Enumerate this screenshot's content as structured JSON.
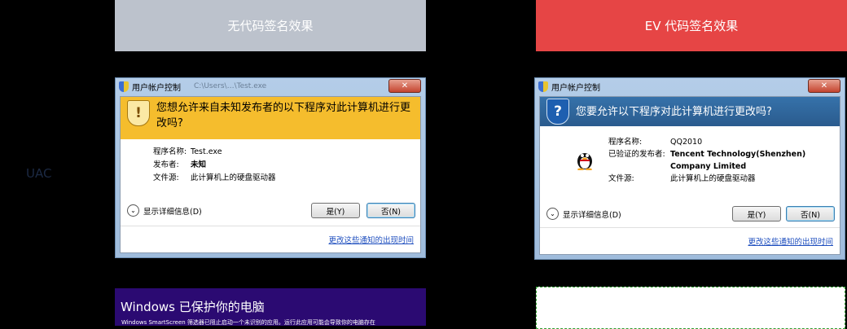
{
  "headers": {
    "left": "无代码签名效果",
    "right": "EV 代码签名效果"
  },
  "row_label": "UAC",
  "uac_left": {
    "title": "用户帐户控制",
    "title_blur": "C:\\Users\\…\\Test.exe",
    "close": "✕",
    "question": "您想允许来自未知发布者的以下程序对此计算机进行更改吗?",
    "program_label": "程序名称:",
    "program_value": "Test.exe",
    "publisher_label": "发布者:",
    "publisher_value": "未知",
    "source_label": "文件源:",
    "source_value": "此计算机上的硬盘驱动器",
    "details": "显示详细信息(D)",
    "yes": "是(Y)",
    "no": "否(N)",
    "change_link": "更改这些通知的出现时间"
  },
  "uac_right": {
    "title": "用户帐户控制",
    "close": "✕",
    "question": "您要允许以下程序对此计算机进行更改吗?",
    "program_label": "程序名称:",
    "program_value": "QQ2010",
    "publisher_label": "已验证的发布者:",
    "publisher_value_line1": "Tencent Technology(Shenzhen)",
    "publisher_value_line2": "Company Limited",
    "source_label": "文件源:",
    "source_value": "此计算机上的硬盘驱动器",
    "details": "显示详细信息(D)",
    "yes": "是(Y)",
    "no": "否(N)",
    "change_link": "更改这些通知的出现时间"
  },
  "smartscreen_left": {
    "title": "Windows 已保护你的电脑",
    "desc": "Windows SmartScreen 筛选器已阻止启动一个未识别的应用。运行此应用可能会导致你的电脑存在"
  },
  "colors": {
    "header_left": "#bcc2cc",
    "header_right": "#e64545",
    "uac_yellow": "#f5bd2d",
    "uac_blue": "#2a5b8e",
    "smartscreen": "#2b0a72"
  }
}
